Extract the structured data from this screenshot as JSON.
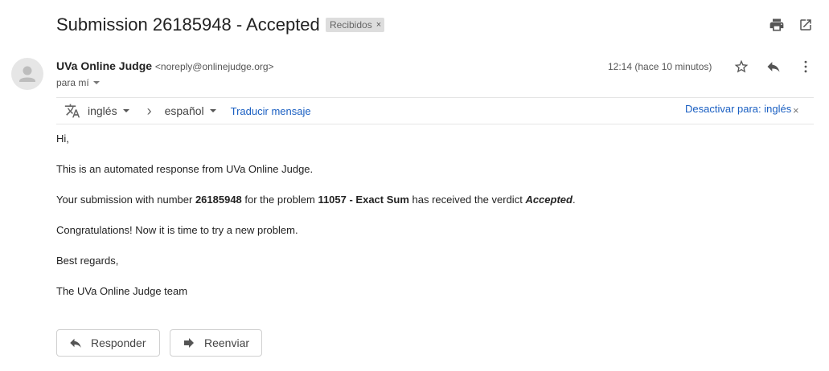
{
  "email": {
    "subject": "Submission 26185948 - Accepted",
    "label": "Recibidos",
    "label_remove": "×",
    "sender_name": "UVa Online Judge",
    "sender_email": "<noreply@onlinejudge.org>",
    "recipient": "para mí",
    "time": "12:14 (hace 10 minutos)"
  },
  "translate": {
    "source_lang": "inglés",
    "target_lang": "español",
    "translate_link": "Traducir mensaje",
    "deactivate": "Desactivar para: inglés",
    "close": "×",
    "arrow": "›"
  },
  "body": {
    "greeting": "Hi,",
    "line1": "This is an automated response from UVa Online Judge.",
    "line2_a": "Your submission with number ",
    "line2_number": "26185948",
    "line2_b": " for the problem ",
    "line2_problem": "11057 - Exact Sum",
    "line2_c": " has received the verdict ",
    "line2_verdict": "Accepted",
    "line2_end": ".",
    "line3": "Congratulations! Now it is time to try a new problem.",
    "line4": "Best regards,",
    "line5": "The UVa Online Judge team"
  },
  "actions": {
    "reply_label": "Responder",
    "forward_label": "Reenviar"
  },
  "icons": {
    "print": "print-icon",
    "popout": "open-in-new-window-icon",
    "star": "star-icon",
    "reply": "reply-icon",
    "more": "more-vertical-icon",
    "translate": "translate-icon",
    "avatar": "person-icon"
  }
}
